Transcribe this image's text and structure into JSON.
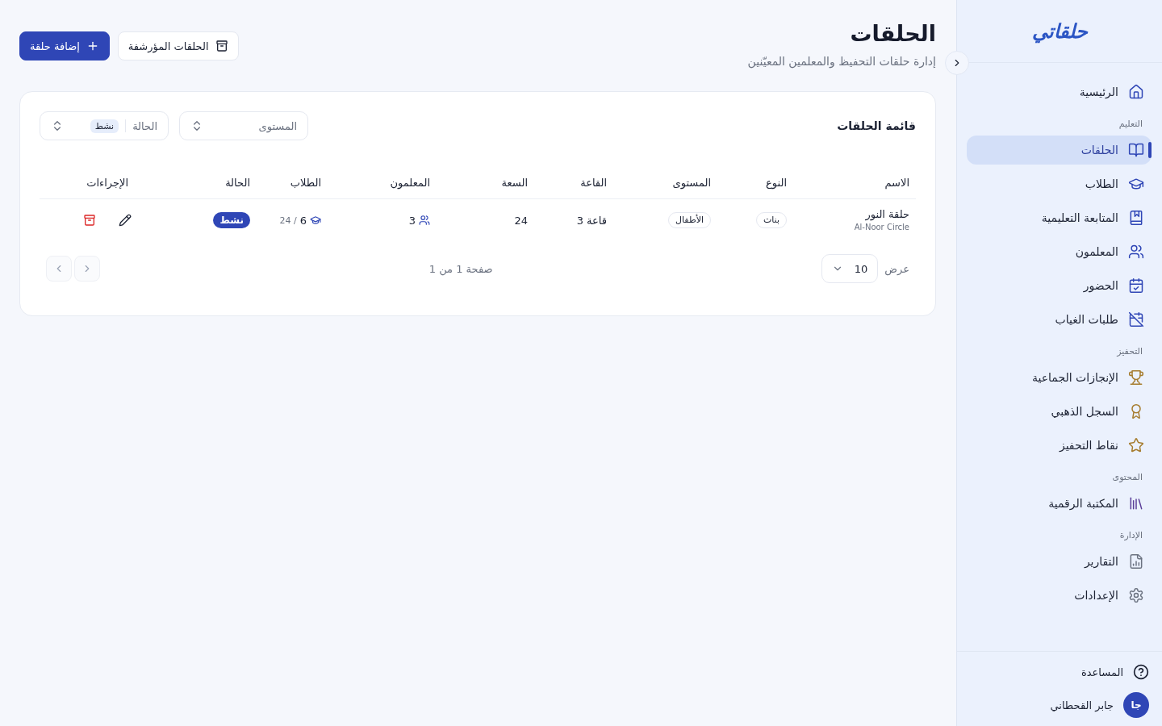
{
  "sidebar": {
    "logo": "حلقاتي",
    "groups": [
      {
        "items": [
          {
            "label": "الرئيسية",
            "selected": false
          }
        ]
      },
      {
        "label": "التعليم",
        "items": [
          {
            "label": "الحلقات",
            "selected": true
          },
          {
            "label": "الطلاب",
            "selected": false
          },
          {
            "label": "المتابعة التعليمية",
            "selected": false
          },
          {
            "label": "المعلمون",
            "selected": false
          },
          {
            "label": "الحضور",
            "selected": false
          },
          {
            "label": "طلبات الغياب",
            "selected": false
          }
        ]
      },
      {
        "label": "التحفيز",
        "items": [
          {
            "label": "الإنجازات الجماعية",
            "selected": false
          },
          {
            "label": "السجل الذهبي",
            "selected": false
          },
          {
            "label": "نقاط التحفيز",
            "selected": false
          }
        ]
      },
      {
        "label": "المحتوى",
        "items": [
          {
            "label": "المكتبة الرقمية",
            "selected": false
          }
        ]
      },
      {
        "label": "الإدارة",
        "items": [
          {
            "label": "التقارير",
            "selected": false
          },
          {
            "label": "الإعدادات",
            "selected": false
          }
        ]
      }
    ],
    "help": "المساعدة",
    "user": {
      "initials": "جا",
      "name": "جابر القحطاني"
    }
  },
  "header": {
    "title": "الحلقات",
    "subtitle": "إدارة حلقات التحفيظ والمعلمين المعيّنين",
    "buttons": [
      {
        "label": "الحلقات المؤرشفة",
        "kind": "secondary"
      },
      {
        "label": "إضافة حلقة",
        "kind": "primary"
      }
    ]
  },
  "card": {
    "title": "قائمة الحلقات",
    "filters": [
      {
        "label": "المستوى"
      },
      {
        "label": "الحالة",
        "value": "نشط"
      }
    ],
    "table": {
      "columns": [
        "الاسم",
        "النوع",
        "المستوى",
        "القاعة",
        "السعة",
        "المعلمون",
        "الطلاب",
        "الحالة",
        "الإجراءات"
      ],
      "rows": [
        {
          "name": "حلقة النور",
          "name_en": "Al-Noor Circle",
          "type": "بنات",
          "level": "الأطفال",
          "hall": "قاعة 3",
          "capacity": "24",
          "teachers": "3",
          "students": "6",
          "students_max": "/ 24",
          "status": "نشط"
        }
      ]
    },
    "footer": {
      "show_label": "عرض",
      "page_size": "10",
      "page_info": "صفحة 1 من 1",
      "pager": [
        {
          "disabled": true
        },
        {
          "disabled": true
        }
      ]
    }
  }
}
